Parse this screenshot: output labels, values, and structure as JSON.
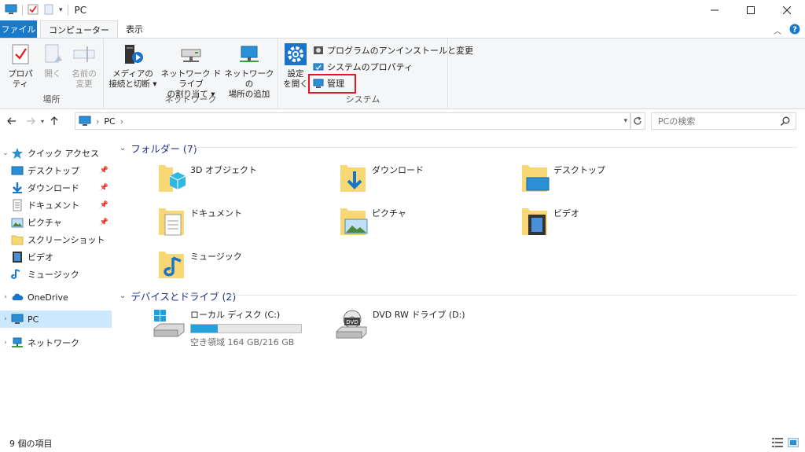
{
  "window": {
    "title": "PC"
  },
  "ribbon_tabs": {
    "file": "ファイル",
    "computer": "コンピューター",
    "view": "表示"
  },
  "ribbon": {
    "location": {
      "label": "場所",
      "properties": "プロパティ",
      "open": "開く",
      "rename_line1": "名前の",
      "rename_line2": "変更"
    },
    "network": {
      "label": "ネットワーク",
      "media_line1": "メディアの",
      "media_line2": "接続と切断 ▾",
      "map_line1": "ネットワーク ドライブ",
      "map_line2": "の割り当て ▾",
      "add_line1": "ネットワークの",
      "add_line2": "場所の追加"
    },
    "system": {
      "label": "システム",
      "settings_line1": "設定",
      "settings_line2": "を開く",
      "uninstall": "プログラムのアンインストールと変更",
      "sysprops": "システムのプロパティ",
      "manage": "管理"
    }
  },
  "address": {
    "crumb": "PC",
    "search_placeholder": "PCの検索"
  },
  "nav": {
    "quick_access": "クイック アクセス",
    "desktop": "デスクトップ",
    "downloads": "ダウンロード",
    "documents": "ドキュメント",
    "pictures": "ピクチャ",
    "screenshots": "スクリーンショット",
    "videos": "ビデオ",
    "music": "ミュージック",
    "onedrive": "OneDrive",
    "pc": "PC",
    "network": "ネットワーク"
  },
  "folders_header": "フォルダー (7)",
  "folders": [
    {
      "name": "3D オブジェクト"
    },
    {
      "name": "ダウンロード"
    },
    {
      "name": "デスクトップ"
    },
    {
      "name": "ドキュメント"
    },
    {
      "name": "ピクチャ"
    },
    {
      "name": "ビデオ"
    },
    {
      "name": "ミュージック"
    }
  ],
  "drives_header": "デバイスとドライブ (2)",
  "drives": [
    {
      "name": "ローカル ディスク (C:)",
      "free": "空き領域 164 GB/216 GB",
      "used_fraction": 0.24
    },
    {
      "name": "DVD RW ドライブ (D:)"
    }
  ],
  "status": {
    "items": "9 個の項目"
  },
  "colors": {
    "accent": "#1979ca",
    "highlight": "#e8161b",
    "selected": "#cce8ff",
    "group_header": "#1e3287"
  }
}
